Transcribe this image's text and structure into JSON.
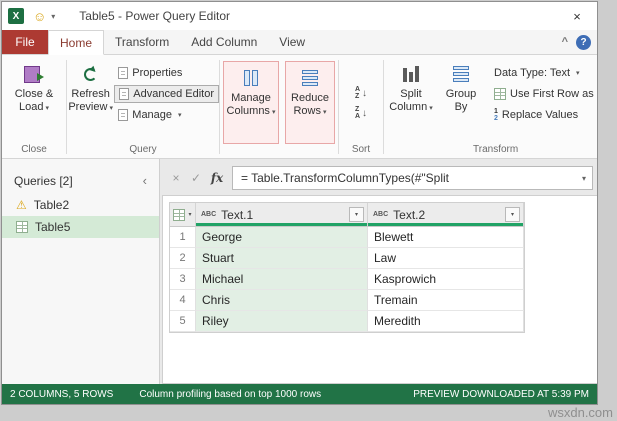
{
  "window": {
    "title": "Table5 - Power Query Editor"
  },
  "glyphs": {
    "excel_logo": "X",
    "smiley": "☺",
    "caret_down": "▾",
    "close": "×",
    "collapse_ribbon": "^",
    "help": "?",
    "cancel": "×",
    "check": "✓",
    "fx": "fx",
    "chevron_left": "‹",
    "warning": "⚠",
    "arrow_down": "↓",
    "letter_a": "A",
    "letter_z": "Z",
    "one": "1",
    "two": "2"
  },
  "tabs": {
    "file": "File",
    "home": "Home",
    "transform": "Transform",
    "add_column": "Add Column",
    "view": "View"
  },
  "ribbon": {
    "close_load": {
      "line1": "Close &",
      "line2": "Load"
    },
    "refresh": {
      "line1": "Refresh",
      "line2": "Preview"
    },
    "properties": "Properties",
    "advanced_editor": "Advanced Editor",
    "manage": "Manage",
    "manage_columns": {
      "line1": "Manage",
      "line2": "Columns"
    },
    "reduce_rows": {
      "line1": "Reduce",
      "line2": "Rows"
    },
    "split_column": {
      "line1": "Split",
      "line2": "Column"
    },
    "group_by": {
      "line1": "Group",
      "line2": "By"
    },
    "data_type": "Data Type: Text",
    "use_first_row": "Use First Row as",
    "replace_values": "Replace Values",
    "groups": {
      "close": "Close",
      "query": "Query",
      "sort": "Sort",
      "transform": "Transform"
    }
  },
  "sidebar": {
    "header": "Queries [2]",
    "items": [
      {
        "label": "Table2"
      },
      {
        "label": "Table5"
      }
    ]
  },
  "formula_bar": {
    "formula": "= Table.TransformColumnTypes(#\"Split"
  },
  "table": {
    "columns": [
      {
        "type": "ABC",
        "label": "Text.1"
      },
      {
        "type": "ABC",
        "label": "Text.2"
      }
    ],
    "rows": [
      {
        "num": "1",
        "cells": [
          "George",
          "Blewett"
        ]
      },
      {
        "num": "2",
        "cells": [
          "Stuart",
          "Law"
        ]
      },
      {
        "num": "3",
        "cells": [
          "Michael",
          "Kasprowich"
        ]
      },
      {
        "num": "4",
        "cells": [
          "Chris",
          "Tremain"
        ]
      },
      {
        "num": "5",
        "cells": [
          "Riley",
          "Meredith"
        ]
      }
    ]
  },
  "status_bar": {
    "left": "2 COLUMNS, 5 ROWS",
    "middle": "Column profiling based on top 1000 rows",
    "right": "PREVIEW DOWNLOADED AT 5:39 PM"
  },
  "watermark": "wsxdn.com",
  "colors": {
    "file_tab": "#ad3a32",
    "status_bar": "#217346",
    "selection_green": "#d4ead6",
    "column_tint_green": "#e2efe4",
    "highlight_border": "#e8a7a7",
    "highlight_fill": "#fdeeee",
    "quality_bar_green": "#21a366"
  }
}
